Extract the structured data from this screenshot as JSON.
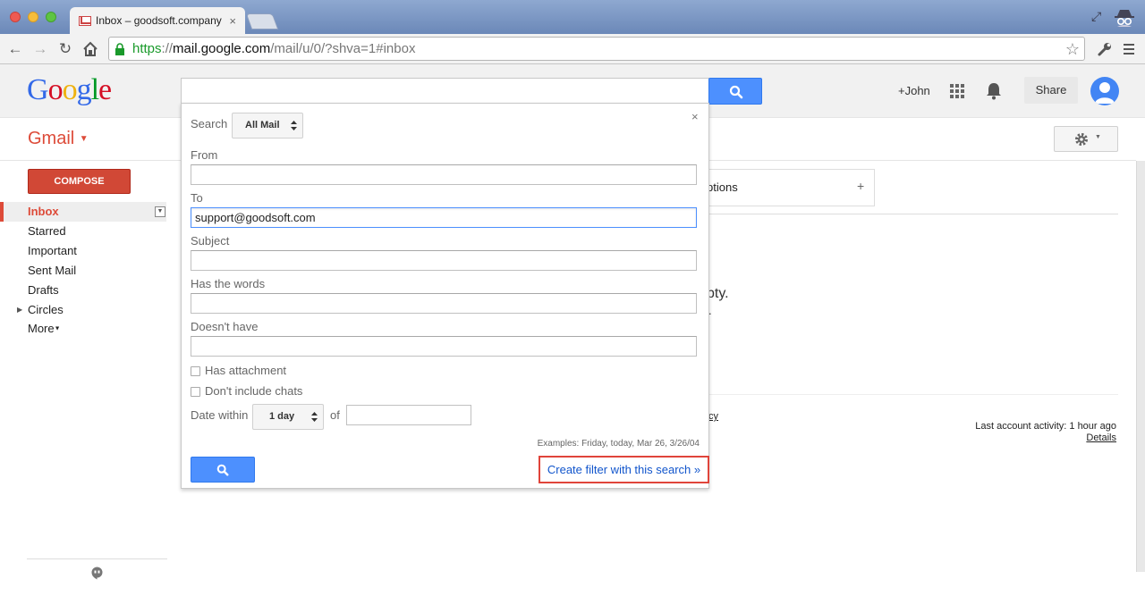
{
  "browser": {
    "tab_title": "Inbox – goodsoft.company",
    "tab_close": "×",
    "url_https": "https",
    "url_sep": "://",
    "url_host": "mail.google.com",
    "url_path": "/mail/u/0/?shva=1#inbox"
  },
  "header": {
    "logo": [
      "G",
      "o",
      "o",
      "g",
      "l",
      "e"
    ],
    "logo_colors": [
      "#3369e8",
      "#d50f25",
      "#eeb211",
      "#3369e8",
      "#009925",
      "#d50f25"
    ],
    "user_plus": "+John",
    "share_label": "Share"
  },
  "app": {
    "label": "Gmail",
    "compose": "COMPOSE"
  },
  "sidebar": {
    "items": [
      {
        "label": "Inbox",
        "active": true
      },
      {
        "label": "Starred"
      },
      {
        "label": "Important"
      },
      {
        "label": "Sent Mail"
      },
      {
        "label": "Drafts"
      },
      {
        "label": "Circles"
      },
      {
        "label": "More"
      }
    ]
  },
  "main": {
    "tab_options_fragment": "ptions",
    "tab_add": "+",
    "empty_fragment": "pty.",
    "empty_fragment2": ".",
    "policy_fragment": "cy",
    "last_activity": "Last account activity: 1 hour ago",
    "details_link": "Details"
  },
  "search_panel": {
    "search_label": "Search",
    "scope_value": "All Mail",
    "close": "×",
    "from_label": "From",
    "from_value": "",
    "to_label": "To",
    "to_value": "support@goodsoft.com",
    "subject_label": "Subject",
    "subject_value": "",
    "words_label": "Has the words",
    "words_value": "",
    "doesnt_label": "Doesn't have",
    "doesnt_value": "",
    "attachment_label": "Has attachment",
    "chats_label": "Don't include chats",
    "date_label": "Date within",
    "date_value": "1 day",
    "of_label": "of",
    "examples": "Examples: Friday, today, Mar 26, 3/26/04",
    "create_filter": "Create filter with this search »"
  },
  "colors": {
    "accent_red": "#dd4b39",
    "search_blue": "#4d90fe",
    "link_blue": "#15c",
    "highlight_box": "#e0443a"
  }
}
